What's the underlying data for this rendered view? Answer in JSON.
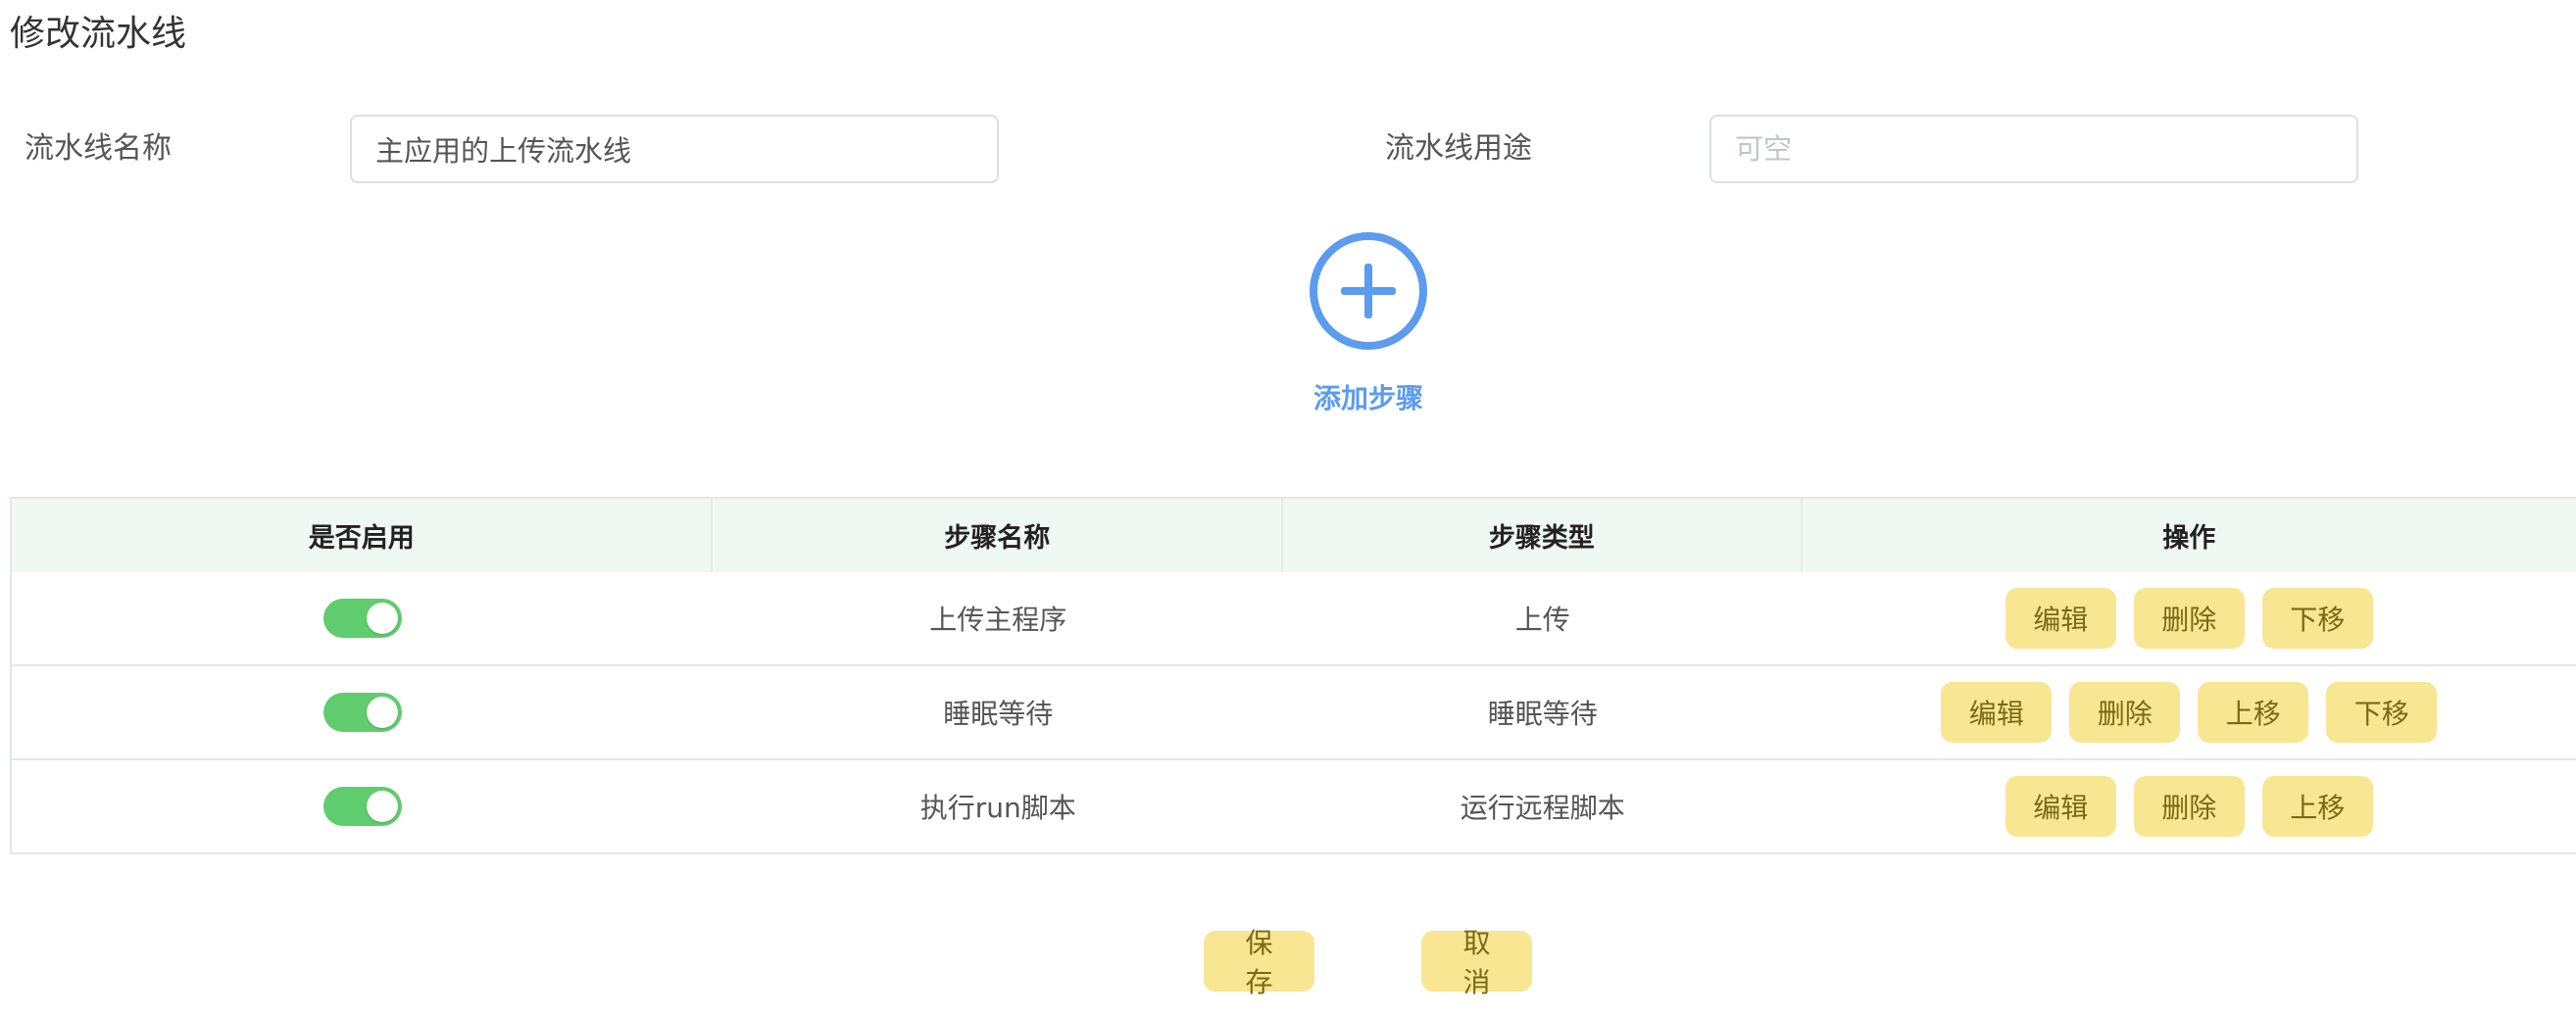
{
  "page": {
    "title": "修改流水线"
  },
  "form": {
    "name_label": "流水线名称",
    "name_value": "主应用的上传流水线",
    "purpose_label": "流水线用途",
    "purpose_value": "",
    "purpose_placeholder": "可空"
  },
  "add_step": {
    "label": "添加步骤",
    "icon": "plus-circle-icon"
  },
  "table": {
    "headers": [
      "是否启用",
      "步骤名称",
      "步骤类型",
      "操作"
    ],
    "rows": [
      {
        "enabled": true,
        "name": "上传主程序",
        "type": "上传",
        "actions": [
          "编辑",
          "删除",
          "下移"
        ]
      },
      {
        "enabled": true,
        "name": "睡眠等待",
        "type": "睡眠等待",
        "actions": [
          "编辑",
          "删除",
          "上移",
          "下移"
        ]
      },
      {
        "enabled": true,
        "name": "执行run脚本",
        "type": "运行远程脚本",
        "actions": [
          "编辑",
          "删除",
          "上移"
        ]
      }
    ]
  },
  "footer": {
    "save_label": "保存",
    "cancel_label": "取消"
  },
  "colors": {
    "accent": "#5b9cf0",
    "toggle_on": "#5fcd6e",
    "action_button": "#f8e693",
    "header_bg": "#f0f8f3"
  }
}
